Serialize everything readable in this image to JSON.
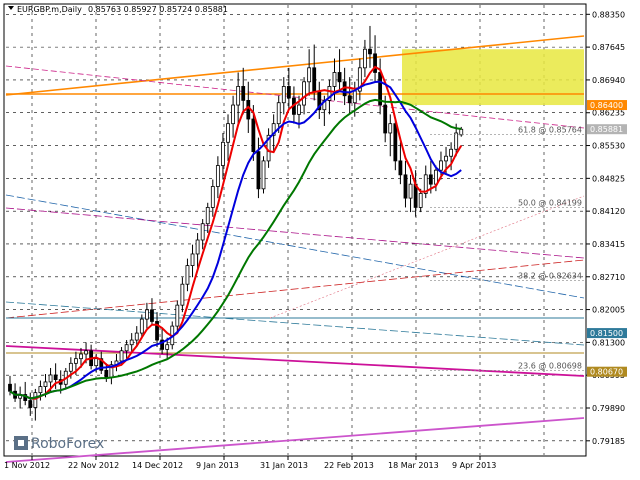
{
  "header": {
    "title": "EURGBP.m,Daily",
    "ohlc": "0.85763 0.85927 0.85724 0.85881"
  },
  "brand": {
    "logo_text": "RoboForex"
  },
  "chart_data": {
    "type": "candlestick",
    "title": "EURGBP.m,Daily",
    "ylim": [
      0.7888,
      0.8855
    ],
    "yticks": [
      "0.88350",
      "0.87645",
      "0.86940",
      "0.86235",
      "0.85530",
      "0.84825",
      "0.84120",
      "0.83415",
      "0.82710",
      "0.82005",
      "0.81300",
      "0.80595",
      "0.79890",
      "0.79185"
    ],
    "xticks": [
      "1 Nov 2012",
      "22 Nov 2012",
      "14 Dec 2012",
      "9 Jan 2013",
      "31 Jan 2013",
      "22 Feb 2013",
      "18 Mar 2013",
      "9 Apr 2013"
    ],
    "grid": true,
    "ohlc": [
      [
        0.804,
        0.8058,
        0.8016,
        0.8025
      ],
      [
        0.8025,
        0.8042,
        0.8002,
        0.801
      ],
      [
        0.801,
        0.8035,
        0.7988,
        0.8018
      ],
      [
        0.8018,
        0.8045,
        0.7995,
        0.8005
      ],
      [
        0.8005,
        0.8022,
        0.7972,
        0.799
      ],
      [
        0.799,
        0.803,
        0.7962,
        0.8022
      ],
      [
        0.8022,
        0.8048,
        0.8005,
        0.8035
      ],
      [
        0.8035,
        0.8062,
        0.8012,
        0.8045
      ],
      [
        0.8045,
        0.8075,
        0.8025,
        0.806
      ],
      [
        0.806,
        0.8085,
        0.803,
        0.805
      ],
      [
        0.805,
        0.807,
        0.802,
        0.804
      ],
      [
        0.804,
        0.8075,
        0.803,
        0.8068
      ],
      [
        0.8068,
        0.8098,
        0.8052,
        0.8085
      ],
      [
        0.8085,
        0.811,
        0.806,
        0.8095
      ],
      [
        0.8095,
        0.8118,
        0.8075,
        0.8105
      ],
      [
        0.8105,
        0.813,
        0.8085,
        0.8112
      ],
      [
        0.8112,
        0.8125,
        0.8072,
        0.808
      ],
      [
        0.808,
        0.8105,
        0.8065,
        0.8095
      ],
      [
        0.8095,
        0.811,
        0.8062,
        0.807
      ],
      [
        0.807,
        0.8085,
        0.8045,
        0.8055
      ],
      [
        0.8055,
        0.809,
        0.804,
        0.8082
      ],
      [
        0.8082,
        0.8105,
        0.8068,
        0.809
      ],
      [
        0.809,
        0.812,
        0.808,
        0.8112
      ],
      [
        0.8112,
        0.8135,
        0.8095,
        0.8125
      ],
      [
        0.8125,
        0.815,
        0.8108,
        0.8135
      ],
      [
        0.8135,
        0.8165,
        0.812,
        0.815
      ],
      [
        0.815,
        0.819,
        0.8138,
        0.818
      ],
      [
        0.818,
        0.8215,
        0.816,
        0.82
      ],
      [
        0.82,
        0.8225,
        0.8168,
        0.8175
      ],
      [
        0.8175,
        0.8195,
        0.812,
        0.8135
      ],
      [
        0.8135,
        0.816,
        0.8105,
        0.8115
      ],
      [
        0.8115,
        0.814,
        0.8095,
        0.8125
      ],
      [
        0.8125,
        0.8175,
        0.8115,
        0.8165
      ],
      [
        0.8165,
        0.822,
        0.815,
        0.821
      ],
      [
        0.821,
        0.827,
        0.8195,
        0.8255
      ],
      [
        0.8255,
        0.831,
        0.824,
        0.8295
      ],
      [
        0.8295,
        0.834,
        0.827,
        0.832
      ],
      [
        0.832,
        0.8365,
        0.829,
        0.835
      ],
      [
        0.835,
        0.8395,
        0.833,
        0.8385
      ],
      [
        0.8385,
        0.843,
        0.8365,
        0.842
      ],
      [
        0.842,
        0.848,
        0.84,
        0.8465
      ],
      [
        0.8465,
        0.853,
        0.844,
        0.851
      ],
      [
        0.851,
        0.858,
        0.848,
        0.856
      ],
      [
        0.856,
        0.862,
        0.852,
        0.86
      ],
      [
        0.86,
        0.866,
        0.857,
        0.864
      ],
      [
        0.864,
        0.871,
        0.86,
        0.868
      ],
      [
        0.868,
        0.872,
        0.862,
        0.865
      ],
      [
        0.865,
        0.869,
        0.858,
        0.861
      ],
      [
        0.861,
        0.864,
        0.852,
        0.854
      ],
      [
        0.854,
        0.857,
        0.844,
        0.846
      ],
      [
        0.846,
        0.853,
        0.845,
        0.852
      ],
      [
        0.852,
        0.859,
        0.8505,
        0.8575
      ],
      [
        0.8575,
        0.862,
        0.854,
        0.86
      ],
      [
        0.86,
        0.866,
        0.858,
        0.8645
      ],
      [
        0.8645,
        0.87,
        0.862,
        0.868
      ],
      [
        0.868,
        0.872,
        0.863,
        0.8655
      ],
      [
        0.8655,
        0.868,
        0.86,
        0.862
      ],
      [
        0.862,
        0.866,
        0.859,
        0.864
      ],
      [
        0.864,
        0.87,
        0.862,
        0.869
      ],
      [
        0.869,
        0.876,
        0.866,
        0.872
      ],
      [
        0.872,
        0.877,
        0.865,
        0.867
      ],
      [
        0.867,
        0.869,
        0.861,
        0.863
      ],
      [
        0.863,
        0.866,
        0.8595,
        0.865
      ],
      [
        0.865,
        0.8695,
        0.862,
        0.868
      ],
      [
        0.868,
        0.874,
        0.865,
        0.871
      ],
      [
        0.871,
        0.876,
        0.867,
        0.869
      ],
      [
        0.869,
        0.872,
        0.864,
        0.866
      ],
      [
        0.866,
        0.87,
        0.862,
        0.8645
      ],
      [
        0.8645,
        0.869,
        0.8615,
        0.867
      ],
      [
        0.867,
        0.874,
        0.865,
        0.872
      ],
      [
        0.872,
        0.878,
        0.87,
        0.876
      ],
      [
        0.876,
        0.881,
        0.872,
        0.875
      ],
      [
        0.875,
        0.879,
        0.869,
        0.871
      ],
      [
        0.871,
        0.874,
        0.862,
        0.864
      ],
      [
        0.864,
        0.866,
        0.856,
        0.858
      ],
      [
        0.858,
        0.862,
        0.853,
        0.86
      ],
      [
        0.86,
        0.861,
        0.85,
        0.852
      ],
      [
        0.852,
        0.856,
        0.847,
        0.849
      ],
      [
        0.849,
        0.852,
        0.842,
        0.844
      ],
      [
        0.844,
        0.849,
        0.841,
        0.847
      ],
      [
        0.847,
        0.85,
        0.84,
        0.842
      ],
      [
        0.842,
        0.846,
        0.841,
        0.845
      ],
      [
        0.845,
        0.851,
        0.844,
        0.849
      ],
      [
        0.849,
        0.852,
        0.845,
        0.847
      ],
      [
        0.847,
        0.851,
        0.8455,
        0.85
      ],
      [
        0.85,
        0.854,
        0.848,
        0.852
      ],
      [
        0.852,
        0.855,
        0.849,
        0.853
      ],
      [
        0.853,
        0.856,
        0.85,
        0.8545
      ],
      [
        0.8545,
        0.86,
        0.853,
        0.858
      ],
      [
        0.8576,
        0.8593,
        0.8572,
        0.8588
      ]
    ],
    "indicators": [
      {
        "name": "MA-fast",
        "color": "#ee0000"
      },
      {
        "name": "MA-mid",
        "color": "#0000dd"
      },
      {
        "name": "MA-slow",
        "color": "#007700"
      }
    ],
    "price_labels": [
      {
        "text": "0.86400",
        "value": 0.864,
        "color": "#ff8800"
      },
      {
        "text": "0.85881",
        "value": 0.85881,
        "color": "#b4b4b4"
      },
      {
        "text": "0.81500",
        "value": 0.815,
        "color": "#2e7a9a"
      },
      {
        "text": "0.80670",
        "value": 0.8067,
        "color": "#b08a20"
      }
    ],
    "fib_levels": [
      {
        "text": "61.8 @ 0.85764",
        "value": 0.85764
      },
      {
        "text": "50.0 @ 0.84199",
        "value": 0.84199
      },
      {
        "text": "38.2 @ 0.82634",
        "value": 0.82634
      },
      {
        "text": "23.6 @ 0.80698",
        "value": 0.80698
      }
    ],
    "highlight_zone": {
      "color": "#e8e840",
      "y_range": [
        0.864,
        0.876
      ]
    }
  }
}
